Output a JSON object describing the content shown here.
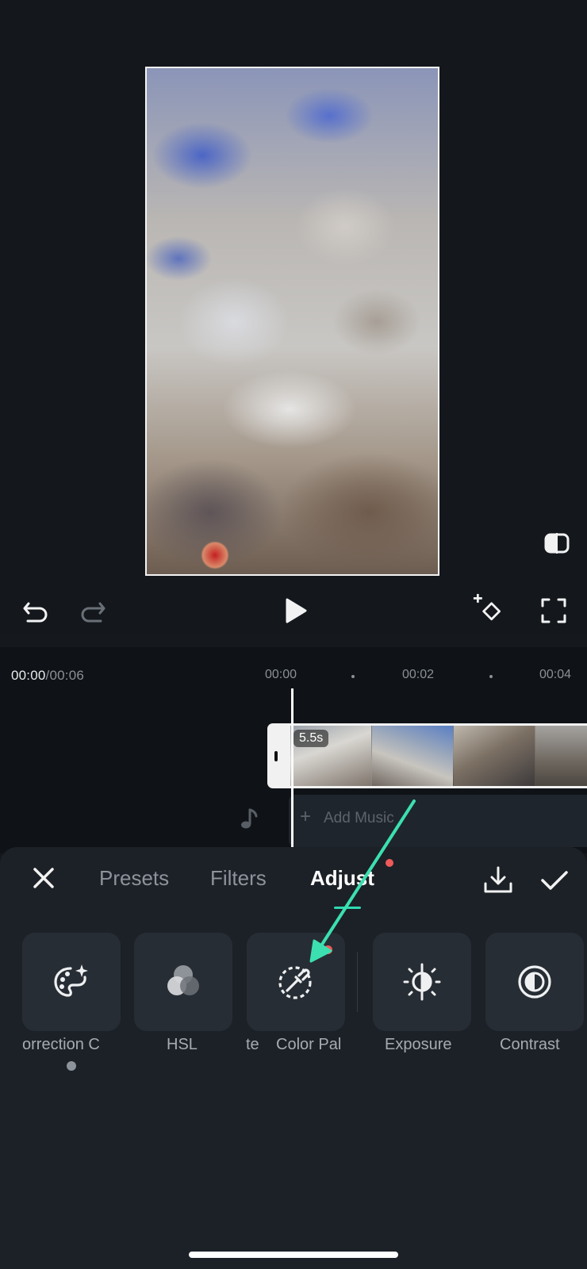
{
  "timeline": {
    "current_time": "00:00",
    "total_time": "/00:06",
    "ruler": [
      "00:00",
      "00:02",
      "00:04"
    ],
    "clip_duration": "5.5s",
    "add_music_label": "Add Music",
    "add_music_plus": "+"
  },
  "panel": {
    "tabs": [
      "Presets",
      "Filters",
      "Adjust"
    ],
    "active_tab": "Adjust",
    "tools": [
      {
        "label": "orrection   C",
        "icon": "palette-sparkle-icon"
      },
      {
        "label": "HSL",
        "icon": "hsl-circles-icon"
      },
      {
        "label": "Color Pal",
        "label_prefix": "te",
        "icon": "eyedropper-icon"
      },
      {
        "label": "Exposure",
        "icon": "exposure-icon"
      },
      {
        "label": "Contrast",
        "icon": "contrast-icon"
      }
    ]
  },
  "colors": {
    "accent": "#2fdbb3",
    "notification_dot": "#f05a5a",
    "annotation_arrow": "#3ce0b0"
  },
  "icons": {
    "toolbar": [
      "undo-icon",
      "redo-icon",
      "play-icon",
      "add-keyframe-icon",
      "fullscreen-icon"
    ],
    "preview": [
      "compare-icon"
    ],
    "panel": [
      "close-icon",
      "download-icon",
      "checkmark-icon",
      "music-note-icon"
    ]
  }
}
